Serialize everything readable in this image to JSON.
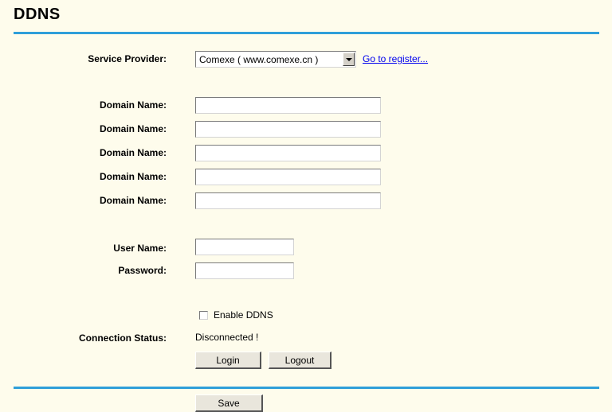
{
  "page": {
    "title": "DDNS"
  },
  "form": {
    "service_provider": {
      "label": "Service Provider:",
      "selected": "Comexe ( www.comexe.cn )",
      "register_link": "Go to register..."
    },
    "domains": [
      {
        "label": "Domain Name:",
        "value": ""
      },
      {
        "label": "Domain Name:",
        "value": ""
      },
      {
        "label": "Domain Name:",
        "value": ""
      },
      {
        "label": "Domain Name:",
        "value": ""
      },
      {
        "label": "Domain Name:",
        "value": ""
      }
    ],
    "user_name": {
      "label": "User Name:",
      "value": ""
    },
    "password": {
      "label": "Password:",
      "value": ""
    },
    "enable_ddns": {
      "label": "Enable DDNS",
      "checked": false
    },
    "connection_status": {
      "label": "Connection Status:",
      "value": "Disconnected !"
    },
    "login_button": "Login",
    "logout_button": "Logout"
  },
  "footer": {
    "save_button": "Save"
  },
  "colors": {
    "accent": "#2f9fd9",
    "background": "#fefcec",
    "link": "#0000ee"
  }
}
